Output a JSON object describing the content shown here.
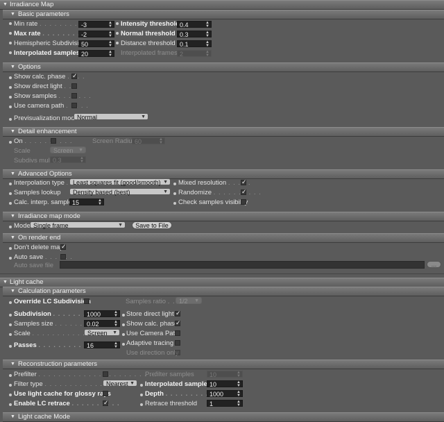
{
  "irradiance": {
    "title": "Irradiance Map",
    "basic": {
      "title": "Basic parameters",
      "min_rate_label": "Min rate",
      "min_rate": "-3",
      "max_rate_label": "Max rate",
      "max_rate": "-2",
      "hemi_label": "Hemispheric Subdivision",
      "hemi": "50",
      "interp_samples_label": "Interpolated samples",
      "interp_samples": "20",
      "intensity_label": "Intensity threshold",
      "intensity": "0.4",
      "normal_label": "Normal threshold",
      "normal": "0.3",
      "distance_label": "Distance threshold",
      "distance": "0.1",
      "interp_frames_label": "Interpolated frames",
      "interp_frames": "2"
    },
    "options": {
      "title": "Options",
      "show_calc_label": "Show calc. phase",
      "show_direct_label": "Show direct light",
      "show_samples_label": "Show samples",
      "camera_path_label": "Use camera path",
      "previs_label": "Previsualization mode",
      "previs_value": "Normal"
    },
    "detail": {
      "title": "Detail enhancement",
      "on_label": "On",
      "screen_radius_label": "Screen Radius",
      "screen_radius": "60",
      "scale_label": "Scale",
      "scale_value": "Screen",
      "subdivs_label": "Subdivs mult.",
      "subdivs": "0.3"
    },
    "advanced": {
      "title": "Advanced Options",
      "interp_type_label": "Interpolation type",
      "interp_type": "Least squares fit (good/smooth)",
      "samples_lookup_label": "Samples lookup",
      "samples_lookup": "Density based (best)",
      "calc_interp_label": "Calc. interp. samples",
      "calc_interp": "15",
      "mixed_res_label": "Mixed resolution",
      "randomize_label": "Randomize",
      "check_vis_label": "Check samples visibility"
    },
    "mode": {
      "title": "Irradiance map mode",
      "mode_label": "Mode",
      "mode_value": "Single frame",
      "save_button": "Save to File"
    },
    "render_end": {
      "title": "On render end",
      "dont_delete_label": "Don't delete map",
      "auto_save_label": "Auto save",
      "auto_save_file_label": "Auto save file",
      "browse_button": "..."
    }
  },
  "light_cache": {
    "title": "Light cache",
    "calc": {
      "title": "Calculation parameters",
      "override_label": "Override LC Subdivision",
      "samples_ratio_label": "Samples ratio",
      "samples_ratio": "1/2",
      "subdivision_label": "Subdivision",
      "subdivision": "1000",
      "samples_size_label": "Samples size",
      "samples_size": "0.02",
      "scale_label": "Scale",
      "scale_value": "Screen",
      "passes_label": "Passes",
      "passes": "16",
      "store_direct_label": "Store direct light",
      "show_calc_label": "Show calc. phase",
      "camera_path_label": "Use Camera Path",
      "adaptive_label": "Adaptive tracing",
      "use_dir_label": "Use direction only"
    },
    "recon": {
      "title": "Reconstruction parameters",
      "prefilter_label": "Prefilter",
      "prefilter_samples_label": "Prefilter samples",
      "prefilter_samples": "10",
      "filter_type_label": "Filter type",
      "filter_type": "Nearest",
      "glossy_label": "Use light cache for glossy rays",
      "retrace_label": "Enable LC retrace",
      "interp_samples_label": "Interpolated samples",
      "interp_samples": "10",
      "depth_label": "Depth",
      "depth": "1000",
      "retrace_thresh_label": "Retrace threshold",
      "retrace_thresh": "1"
    },
    "mode_title": "Light cache Mode"
  }
}
